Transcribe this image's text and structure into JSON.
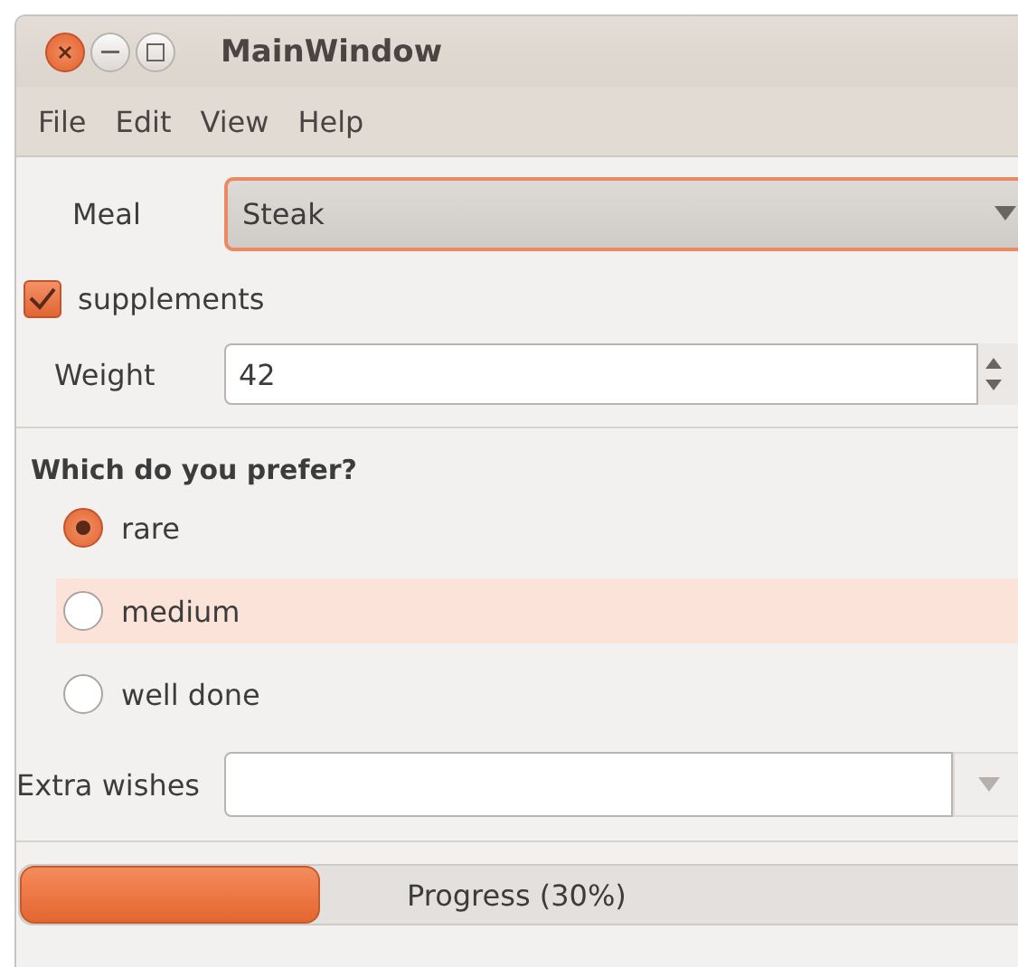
{
  "window": {
    "title": "MainWindow"
  },
  "menu": [
    "File",
    "Edit",
    "View",
    "Help"
  ],
  "meal": {
    "label": "Meal",
    "value": "Steak"
  },
  "supplements": {
    "label": "supplements",
    "checked": true
  },
  "weight": {
    "label": "Weight",
    "value": "42"
  },
  "preference": {
    "title": "Which do you prefer?",
    "options": [
      {
        "label": "rare",
        "selected": true,
        "highlighted": false
      },
      {
        "label": "medium",
        "selected": false,
        "highlighted": true
      },
      {
        "label": "well done",
        "selected": false,
        "highlighted": false
      }
    ]
  },
  "extra_wishes": {
    "label": "Extra wishes"
  },
  "progress": {
    "text": "Progress (30%)",
    "level": 0.3
  }
}
